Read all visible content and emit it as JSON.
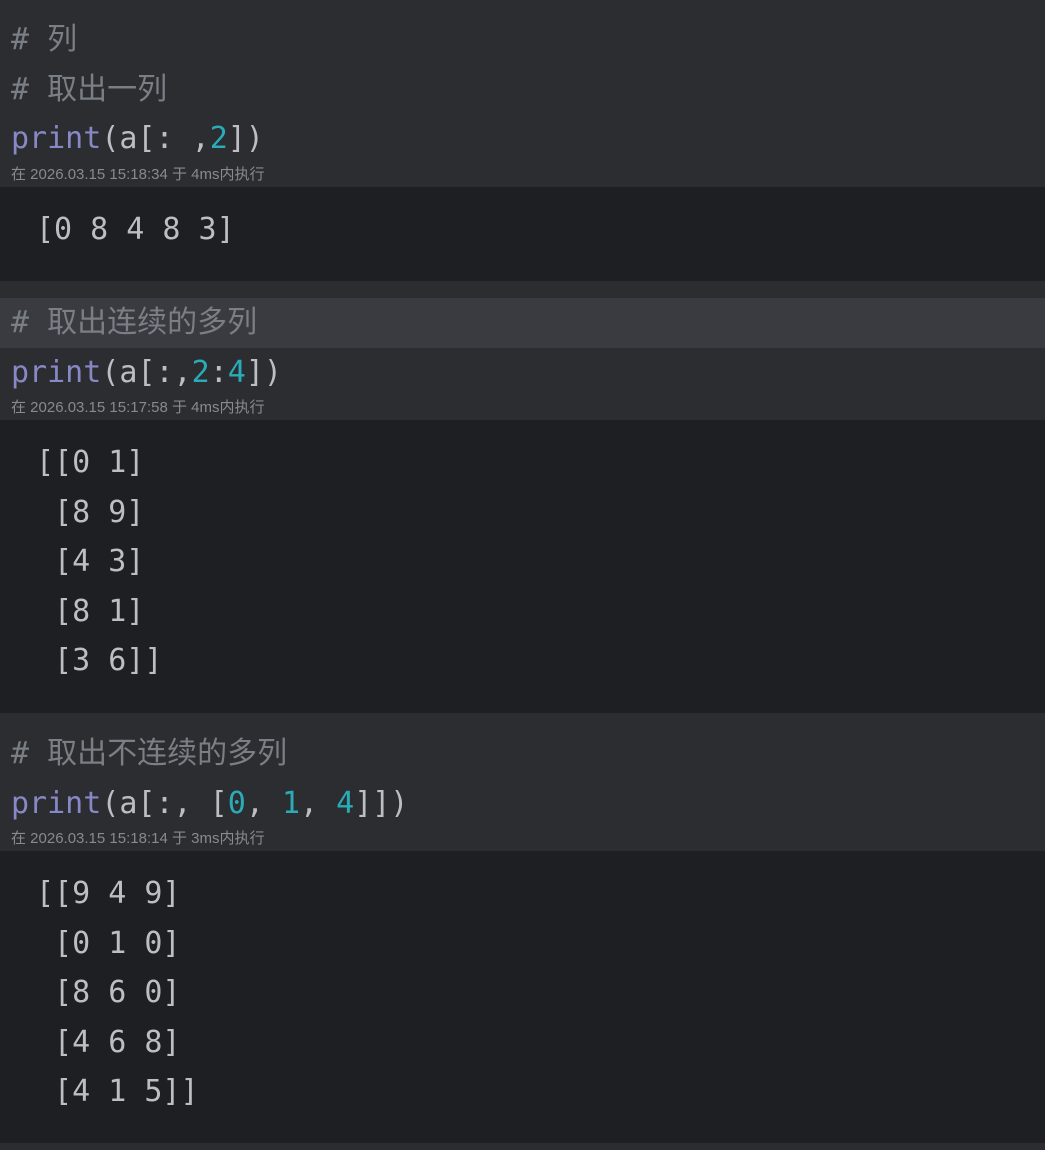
{
  "cells": [
    {
      "comments": [
        "# 列",
        "# 取出一列"
      ],
      "code": {
        "kw": "print",
        "parts": [
          [
            "plain",
            "(a[: ,"
          ],
          [
            "num",
            "2"
          ],
          [
            "plain",
            "])"
          ]
        ]
      },
      "meta": "在 2026.03.15 15:18:34 于 4ms内执行",
      "output": [
        "[0 8 4 8 3]"
      ]
    },
    {
      "comments": [
        "# 取出连续的多列"
      ],
      "code": {
        "kw": "print",
        "parts": [
          [
            "plain",
            "(a[:,"
          ],
          [
            "num",
            "2"
          ],
          [
            "plain",
            ":"
          ],
          [
            "num",
            "4"
          ],
          [
            "plain",
            "])"
          ]
        ]
      },
      "meta": "在 2026.03.15 15:17:58 于 4ms内执行",
      "output": [
        "[[0 1]",
        " [8 9]",
        " [4 3]",
        " [8 1]",
        " [3 6]]"
      ]
    },
    {
      "comments": [
        "# 取出不连续的多列"
      ],
      "code": {
        "kw": "print",
        "parts": [
          [
            "plain",
            "(a[:, ["
          ],
          [
            "num",
            "0"
          ],
          [
            "plain",
            ", "
          ],
          [
            "num",
            "1"
          ],
          [
            "plain",
            ", "
          ],
          [
            "num",
            "4"
          ],
          [
            "plain",
            "]])"
          ]
        ]
      },
      "meta": "在 2026.03.15 15:18:14 于 3ms内执行",
      "output": [
        "[[9 4 9]",
        " [0 1 0]",
        " [8 6 0]",
        " [4 6 8]",
        " [4 1 5]]"
      ]
    }
  ]
}
